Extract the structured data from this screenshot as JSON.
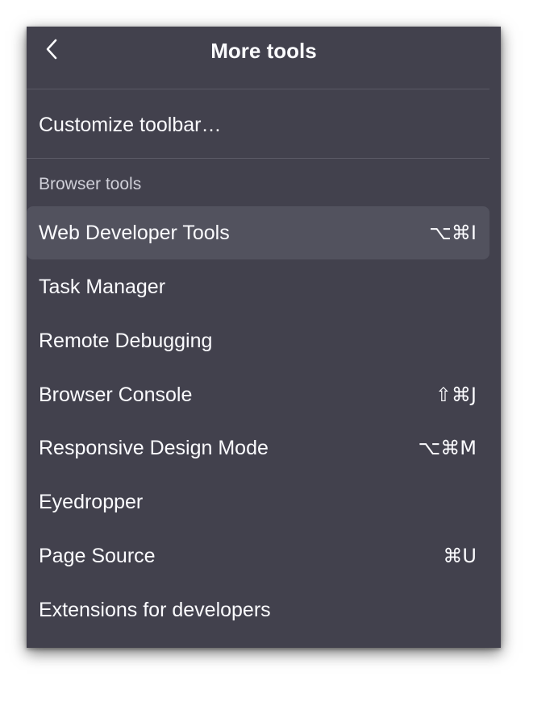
{
  "header": {
    "title": "More tools",
    "back_icon": "chevron-left-icon"
  },
  "customize": {
    "label": "Customize toolbar…"
  },
  "section": {
    "heading": "Browser tools"
  },
  "items": [
    {
      "label": "Web Developer Tools",
      "shortcut": "⌥⌘I",
      "highlighted": true
    },
    {
      "label": "Task Manager",
      "shortcut": ""
    },
    {
      "label": "Remote Debugging",
      "shortcut": ""
    },
    {
      "label": "Browser Console",
      "shortcut": "⇧⌘J"
    },
    {
      "label": "Responsive Design Mode",
      "shortcut": "⌥⌘M"
    },
    {
      "label": "Eyedropper",
      "shortcut": ""
    },
    {
      "label": "Page Source",
      "shortcut": "⌘U"
    },
    {
      "label": "Extensions for developers",
      "shortcut": ""
    }
  ],
  "colors": {
    "panel_bg": "#42414d",
    "hover_bg": "#52525e",
    "text": "#fbfbfe",
    "muted_text": "#cfcfd8",
    "separator": "#5b5a66"
  }
}
